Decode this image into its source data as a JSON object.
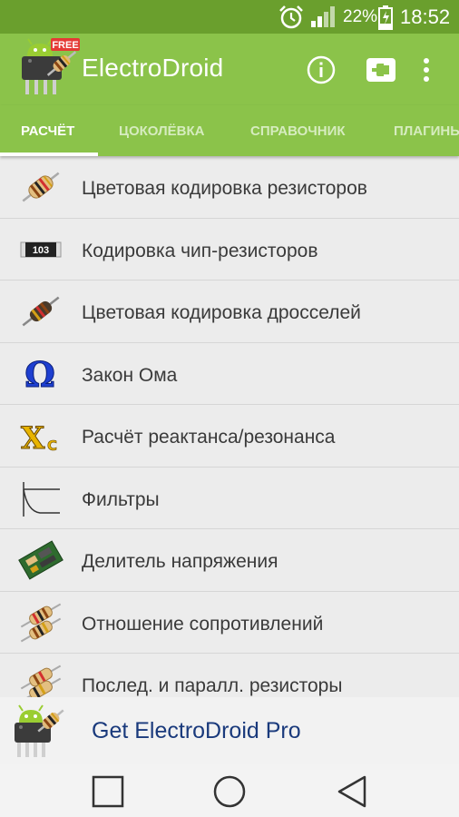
{
  "status_bar": {
    "battery_percent": "22%",
    "time": "18:52",
    "icons": [
      "alarm-icon",
      "signal-icon",
      "battery-charging-icon"
    ]
  },
  "app_bar": {
    "title": "ElectroDroid",
    "logo_badge": "FREE",
    "actions": [
      "info-icon",
      "plugin-icon",
      "more-vert-icon"
    ]
  },
  "tabs": [
    {
      "label": "РАСЧЁТ",
      "active": true
    },
    {
      "label": "ЦОКОЛЁВКА",
      "active": false
    },
    {
      "label": "СПРАВОЧНИК",
      "active": false
    },
    {
      "label": "ПЛАГИНЫ",
      "active": false
    }
  ],
  "list": {
    "items": [
      {
        "label": "Цветовая кодировка резисторов",
        "icon": "resistor-icon"
      },
      {
        "label": "Кодировка чип-резисторов",
        "icon": "chip-resistor-icon",
        "icon_text": "103"
      },
      {
        "label": "Цветовая кодировка дросселей",
        "icon": "inductor-icon"
      },
      {
        "label": "Закон Ома",
        "icon": "omega-icon",
        "icon_text": "Ω"
      },
      {
        "label": "Расчёт реактанса/резонанса",
        "icon": "reactance-icon",
        "icon_text": "X",
        "icon_subtext": "C"
      },
      {
        "label": "Фильтры",
        "icon": "filter-curve-icon"
      },
      {
        "label": "Делитель напряжения",
        "icon": "circuit-board-icon"
      },
      {
        "label": "Отношение сопротивлений",
        "icon": "resistor-pair-icon"
      },
      {
        "label": "Послед. и паралл. резисторы",
        "icon": "resistor-network-icon"
      }
    ]
  },
  "promo": {
    "text": "Get ElectroDroid Pro",
    "icon": "electrodroid-logo-icon"
  },
  "nav_bar": {
    "buttons": [
      "recents-icon",
      "home-icon",
      "back-icon"
    ]
  },
  "colors": {
    "status_bar": "#6a9f2d",
    "app_bar": "#8bc34a",
    "tab_active": "#ffffff",
    "tab_inactive": "#d6ecbf",
    "list_bg": "#ececec",
    "list_text": "#3a3a3a",
    "promo_text": "#1a3a7c"
  }
}
